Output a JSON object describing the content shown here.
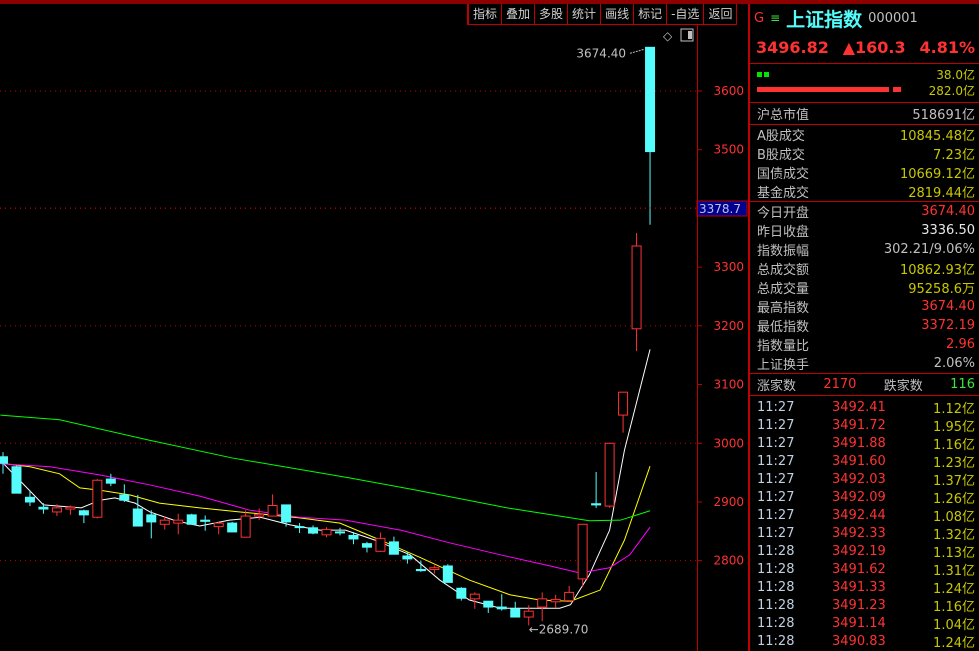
{
  "toolbar": [
    "指标",
    "叠加",
    "多股",
    "统计",
    "画线",
    "标记",
    "-自选",
    "返回"
  ],
  "panel": {
    "g": "G",
    "menu": "≡",
    "title": "上证指数",
    "code": "000001",
    "price": "3496.82",
    "change": "▲160.3",
    "pct": "4.81%",
    "bar1": "38.0亿",
    "bar2": "282.0亿",
    "mcap": {
      "label": "沪总市值",
      "value": "518691亿"
    },
    "turnover": [
      {
        "label": "A股成交",
        "value": "10845.48亿"
      },
      {
        "label": "B股成交",
        "value": "7.23亿"
      },
      {
        "label": "国债成交",
        "value": "10669.12亿"
      },
      {
        "label": "基金成交",
        "value": "2819.44亿"
      }
    ],
    "stats": [
      {
        "label": "今日开盘",
        "value": "3674.40",
        "color": "r"
      },
      {
        "label": "昨日收盘",
        "value": "3336.50",
        "color": "w"
      },
      {
        "label": "指数振幅",
        "value": "302.21/9.06%",
        "color": "lb"
      },
      {
        "label": "总成交额",
        "value": "10862.93亿",
        "color": "y"
      },
      {
        "label": "总成交量",
        "value": "95258.6万",
        "color": "y"
      },
      {
        "label": "最高指数",
        "value": "3674.40",
        "color": "r"
      },
      {
        "label": "最低指数",
        "value": "3372.19",
        "color": "r"
      },
      {
        "label": "指数量比",
        "value": "2.96",
        "color": "r"
      },
      {
        "label": "上证换手",
        "value": "2.06%",
        "color": "lb"
      }
    ],
    "up_label": "涨家数",
    "up": "2170",
    "down_label": "跌家数",
    "down": "116",
    "ticks": [
      [
        "11:27",
        "3492.41",
        "1.12亿"
      ],
      [
        "11:27",
        "3491.72",
        "1.95亿"
      ],
      [
        "11:27",
        "3491.88",
        "1.16亿"
      ],
      [
        "11:27",
        "3491.60",
        "1.23亿"
      ],
      [
        "11:27",
        "3492.03",
        "1.37亿"
      ],
      [
        "11:27",
        "3492.09",
        "1.26亿"
      ],
      [
        "11:27",
        "3492.44",
        "1.08亿"
      ],
      [
        "11:27",
        "3492.33",
        "1.32亿"
      ],
      [
        "11:28",
        "3492.19",
        "1.13亿"
      ],
      [
        "11:28",
        "3491.62",
        "1.31亿"
      ],
      [
        "11:28",
        "3491.33",
        "1.24亿"
      ],
      [
        "11:28",
        "3491.23",
        "1.16亿"
      ],
      [
        "11:28",
        "3491.14",
        "1.04亿"
      ],
      [
        "11:28",
        "3490.83",
        "1.24亿"
      ]
    ]
  },
  "chart_data": {
    "type": "candlestick",
    "y_ticks": [
      3600,
      3500,
      3400,
      3300,
      3200,
      3100,
      3000,
      2900,
      2800
    ],
    "gridlines": [
      3600,
      3400,
      3200,
      3000,
      2800
    ],
    "crosshair_value": "3378.7",
    "high_label": "3674.40",
    "low_label": "2689.70",
    "up_color": "#ff3232",
    "down_color": "#54fcfc",
    "ohlc": [
      [
        2977,
        2985,
        2948,
        2966
      ],
      [
        2960,
        2962,
        2915,
        2915
      ],
      [
        2908,
        2920,
        2893,
        2900
      ],
      [
        2891,
        2898,
        2880,
        2888
      ],
      [
        2883,
        2896,
        2876,
        2890
      ],
      [
        2888,
        2894,
        2878,
        2891
      ],
      [
        2885,
        2887,
        2864,
        2878
      ],
      [
        2874,
        2939,
        2872,
        2937
      ],
      [
        2939,
        2948,
        2927,
        2932
      ],
      [
        2912,
        2930,
        2900,
        2903
      ],
      [
        2888,
        2912,
        2859,
        2859
      ],
      [
        2878,
        2886,
        2838,
        2866
      ],
      [
        2862,
        2876,
        2853,
        2869
      ],
      [
        2864,
        2880,
        2845,
        2869
      ],
      [
        2878,
        2880,
        2862,
        2862
      ],
      [
        2869,
        2877,
        2851,
        2867
      ],
      [
        2858,
        2866,
        2845,
        2864
      ],
      [
        2864,
        2866,
        2849,
        2849
      ],
      [
        2840,
        2886,
        2840,
        2876
      ],
      [
        2876,
        2889,
        2869,
        2879
      ],
      [
        2876,
        2913,
        2876,
        2894
      ],
      [
        2895,
        2895,
        2858,
        2866
      ],
      [
        2858,
        2864,
        2847,
        2857
      ],
      [
        2856,
        2860,
        2845,
        2847
      ],
      [
        2844,
        2857,
        2840,
        2853
      ],
      [
        2849,
        2856,
        2843,
        2848
      ],
      [
        2843,
        2849,
        2828,
        2837
      ],
      [
        2829,
        2832,
        2814,
        2823
      ],
      [
        2816,
        2848,
        2815,
        2838
      ],
      [
        2832,
        2841,
        2811,
        2811
      ],
      [
        2808,
        2815,
        2795,
        2803
      ],
      [
        2785,
        2800,
        2781,
        2783
      ],
      [
        2785,
        2792,
        2778,
        2788
      ],
      [
        2791,
        2794,
        2763,
        2763
      ],
      [
        2753,
        2755,
        2732,
        2736
      ],
      [
        2735,
        2746,
        2718,
        2743
      ],
      [
        2731,
        2731,
        2711,
        2721
      ],
      [
        2721,
        2743,
        2715,
        2718
      ],
      [
        2718,
        2730,
        2704,
        2704
      ],
      [
        2704,
        2724,
        2689.7,
        2714
      ],
      [
        2721,
        2746,
        2697,
        2735
      ],
      [
        2730,
        2742,
        2720,
        2734
      ],
      [
        2732,
        2757,
        2730,
        2746
      ],
      [
        2769,
        2862,
        2755,
        2862
      ],
      [
        2897,
        2951,
        2890,
        2895
      ],
      [
        2893,
        3001,
        2890,
        3000
      ],
      [
        3048,
        3087,
        3018,
        3087
      ],
      [
        3195,
        3358,
        3157,
        3336
      ],
      [
        3674.4,
        3674.4,
        3372.19,
        3496.82
      ]
    ],
    "ma": [
      {
        "name": "MA5",
        "color": "#ffffff",
        "points": [
          [
            -0.2,
            2971
          ],
          [
            3,
            2895
          ],
          [
            5.8,
            2890
          ],
          [
            7.2,
            2903
          ],
          [
            8.3,
            2907
          ],
          [
            9.8,
            2898
          ],
          [
            10.9,
            2883
          ],
          [
            12.8,
            2868
          ],
          [
            14.6,
            2859
          ],
          [
            16.8,
            2869
          ],
          [
            19.1,
            2874
          ],
          [
            21.3,
            2861
          ],
          [
            23.5,
            2852
          ],
          [
            25.4,
            2852
          ],
          [
            27.6,
            2835
          ],
          [
            30.2,
            2810
          ],
          [
            32.4,
            2767
          ],
          [
            34.6,
            2733
          ],
          [
            36.9,
            2719
          ],
          [
            39.1,
            2719
          ],
          [
            41.3,
            2719
          ],
          [
            42.1,
            2725
          ],
          [
            43.5,
            2776
          ],
          [
            45,
            2852
          ],
          [
            46.1,
            2988
          ],
          [
            48,
            3160
          ]
        ]
      },
      {
        "name": "MA10",
        "color": "#ffff00",
        "points": [
          [
            -0.2,
            2966
          ],
          [
            2,
            2960
          ],
          [
            4.2,
            2948
          ],
          [
            5.7,
            2924
          ],
          [
            7.2,
            2920
          ],
          [
            9.4,
            2912
          ],
          [
            11.6,
            2898
          ],
          [
            14.6,
            2890
          ],
          [
            17.6,
            2883
          ],
          [
            22,
            2873
          ],
          [
            25,
            2864
          ],
          [
            28,
            2835
          ],
          [
            30.9,
            2806
          ],
          [
            34.6,
            2767
          ],
          [
            37.6,
            2742
          ],
          [
            39.8,
            2733
          ],
          [
            42.1,
            2731
          ],
          [
            44.3,
            2750
          ],
          [
            46.1,
            2835
          ],
          [
            48,
            2961
          ]
        ]
      },
      {
        "name": "MA20",
        "color": "#ff00ff",
        "points": [
          [
            -0.2,
            2965
          ],
          [
            3.5,
            2960
          ],
          [
            7.2,
            2946
          ],
          [
            10.9,
            2929
          ],
          [
            14.6,
            2910
          ],
          [
            18.3,
            2886
          ],
          [
            22,
            2874
          ],
          [
            25.4,
            2869
          ],
          [
            29.5,
            2852
          ],
          [
            33.2,
            2830
          ],
          [
            36.9,
            2810
          ],
          [
            40.6,
            2791
          ],
          [
            42.8,
            2779
          ],
          [
            45,
            2788
          ],
          [
            46.5,
            2810
          ],
          [
            48,
            2857
          ]
        ]
      },
      {
        "name": "MA60",
        "color": "#00ff00",
        "points": [
          [
            -0.2,
            3048
          ],
          [
            4.2,
            3040
          ],
          [
            10.7,
            3006
          ],
          [
            17,
            2975
          ],
          [
            25.7,
            2941
          ],
          [
            30.7,
            2920
          ],
          [
            37.4,
            2890
          ],
          [
            43.5,
            2868
          ],
          [
            45.8,
            2869
          ],
          [
            48,
            2885
          ]
        ]
      }
    ]
  }
}
